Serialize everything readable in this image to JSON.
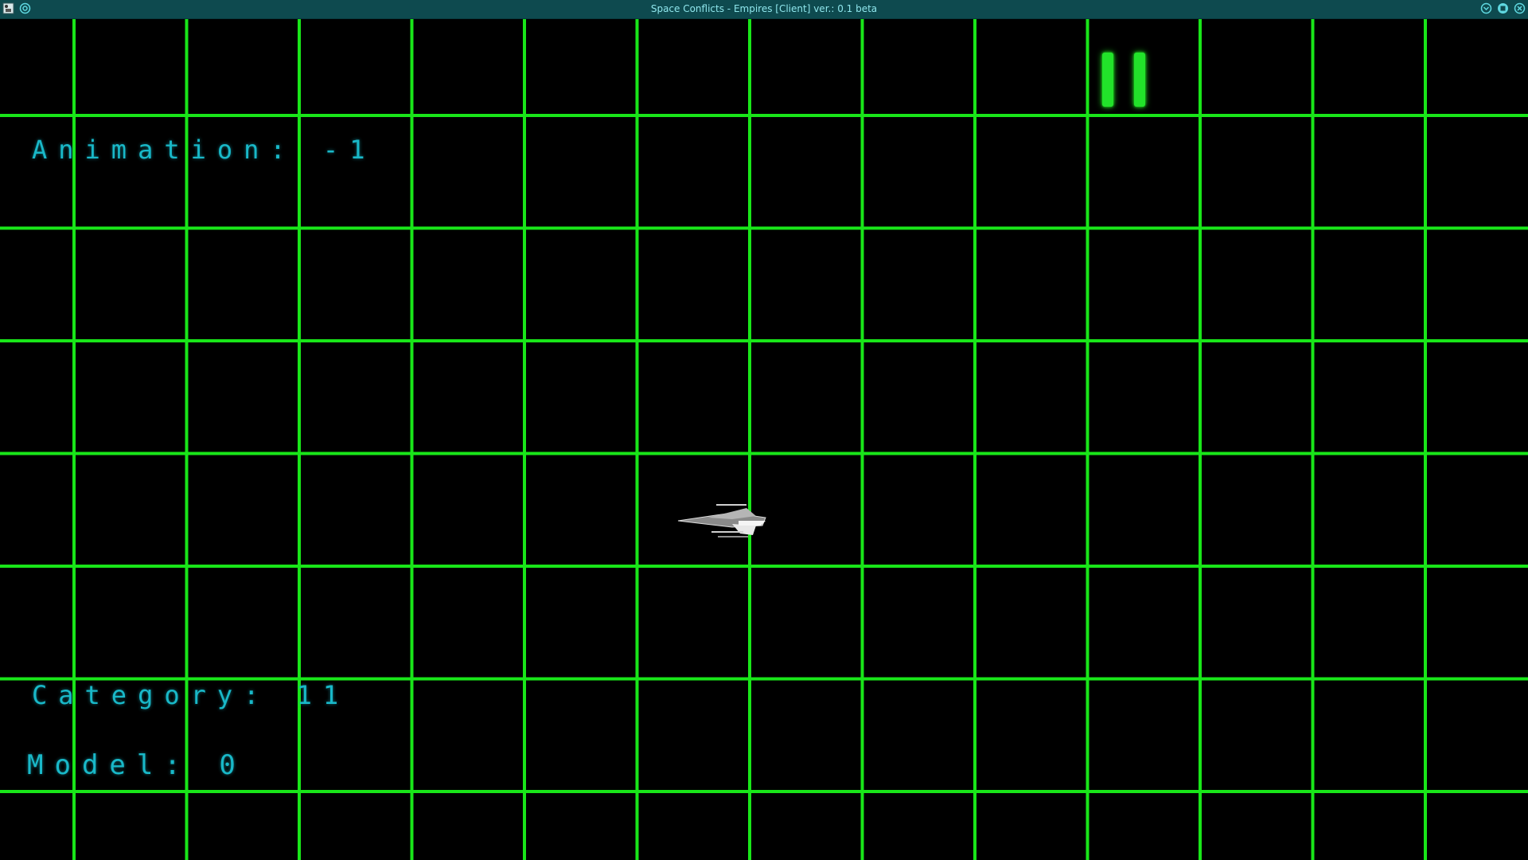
{
  "window": {
    "title": "Space Conflicts - Empires [Client] ver.: 0.1 beta"
  },
  "hud": {
    "animation_label": "Animation:",
    "animation_value": "-1",
    "category_label": "Category:",
    "category_value": "11",
    "model_label": "Model:",
    "model_value": "0"
  },
  "colors": {
    "grid": "#19e619",
    "hud_text": "#19b8c8",
    "titlebar": "#0e4a4f",
    "background": "#000000"
  },
  "icons": {
    "app": "app-icon",
    "settings": "settings-icon",
    "minimize": "minimize-icon",
    "maximize": "maximize-icon",
    "close": "close-icon",
    "pause": "pause-icon",
    "ship": "spaceship-icon"
  }
}
